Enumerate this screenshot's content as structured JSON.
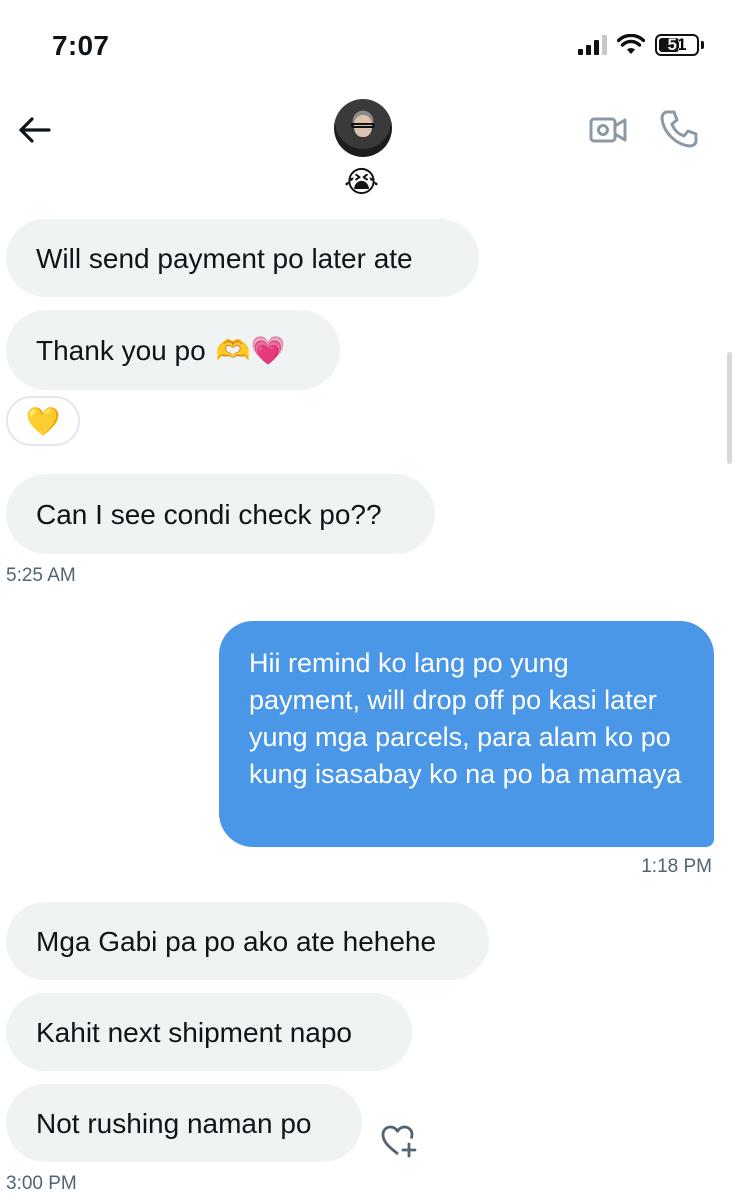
{
  "status_bar": {
    "time": "7:07",
    "battery": "51"
  },
  "header": {
    "name": "😭"
  },
  "messages": [
    {
      "text": "Will send payment po later ate"
    },
    {
      "text": "Thank you po",
      "emoji": "🫶💗"
    },
    {
      "reaction": "💛"
    },
    {
      "text": "Can I see condi check po??"
    },
    {
      "time": "5:25 AM"
    },
    {
      "text": "Hii remind ko lang po yung payment, will drop off po kasi later yung mga parcels, para alam ko po kung isasabay ko na po ba mamaya"
    },
    {
      "time": "1:18 PM"
    },
    {
      "text": "Mga Gabi pa po ako ate hehehe"
    },
    {
      "text": "Kahit next shipment napo"
    },
    {
      "text": "Not rushing naman po"
    },
    {
      "time": "3:00 PM"
    }
  ]
}
